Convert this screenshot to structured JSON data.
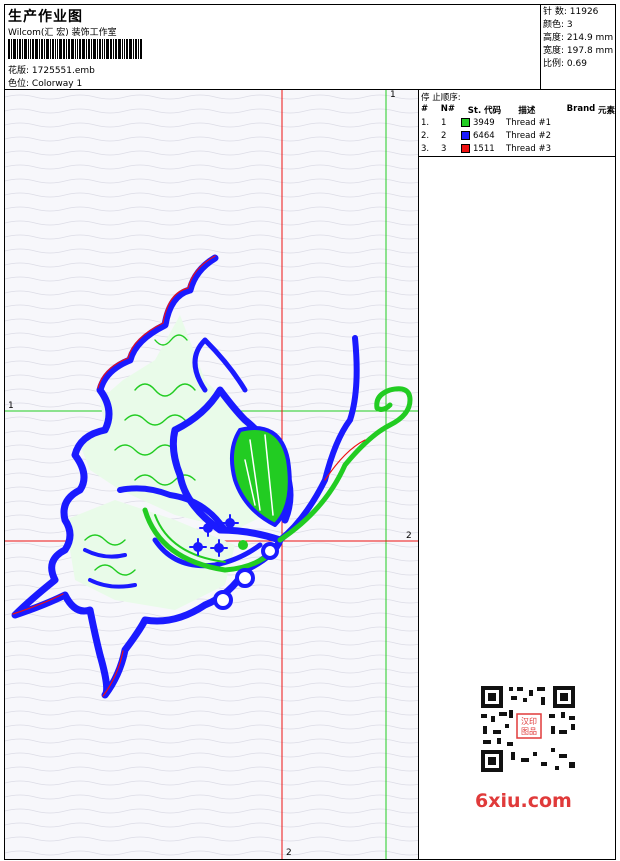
{
  "header": {
    "title": "生产作业图",
    "subtitle": "Wilcom(汇 宏) 装饰工作室",
    "design_label": "花版:",
    "design_value": "1725551.emb",
    "colorway_label": "色位:",
    "colorway_value": "Colorway 1"
  },
  "stats": [
    {
      "label": "针 数:",
      "value": "11926"
    },
    {
      "label": "颜色:",
      "value": "3"
    },
    {
      "label": "高度:",
      "value": "214.9 mm"
    },
    {
      "label": "宽度:",
      "value": "197.8 mm"
    },
    {
      "label": "比例:",
      "value": "0.69"
    }
  ],
  "stop_sequence": {
    "title": "停 止顺序:",
    "columns": [
      "#",
      "N#",
      "St.",
      "代码",
      "描述",
      "Brand",
      "元素"
    ],
    "rows": [
      {
        "idx": "1.",
        "n": "1",
        "code": "3949",
        "desc": "Thread #1",
        "color": "#22cc22"
      },
      {
        "idx": "2.",
        "n": "2",
        "code": "6464",
        "desc": "Thread #2",
        "color": "#1a1aff"
      },
      {
        "idx": "3.",
        "n": "3",
        "code": "1511",
        "desc": "Thread #3",
        "color": "#ee1111"
      }
    ]
  },
  "guides": {
    "v_green": "1",
    "h_green": "1",
    "h_red": "2",
    "v_red": "2"
  },
  "watermark": {
    "logo_text": "6xiu.com",
    "stamp_text": "汉印图品"
  },
  "colors": {
    "green": "#22cc22",
    "blue": "#1a1aff",
    "red": "#ee1111"
  }
}
